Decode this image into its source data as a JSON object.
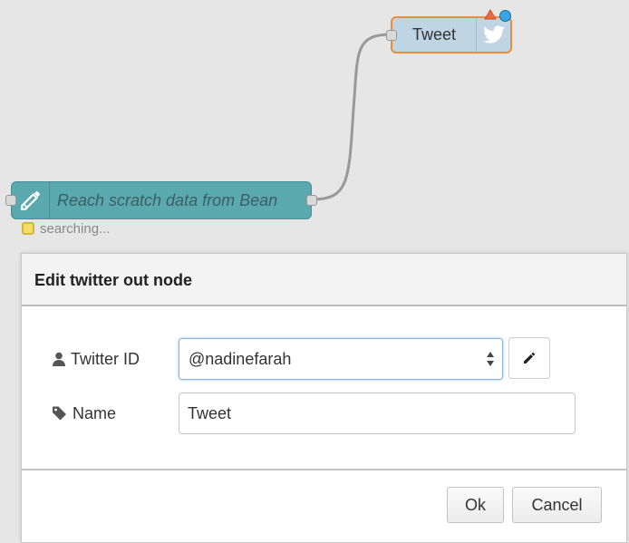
{
  "flow": {
    "tweet_node": {
      "label": "Tweet",
      "icon": "twitter-bird-icon",
      "fill": "#c0d5e3",
      "border": "#f08b3b"
    },
    "inject_node": {
      "label": "Reach scratch data from Bean",
      "icon": "pencil-icon",
      "fill": "#5aa9ae"
    },
    "status": {
      "text": "searching...",
      "color": "#f0e068"
    }
  },
  "dialog": {
    "title": "Edit twitter out node",
    "fields": {
      "twitter_id": {
        "label": "Twitter ID",
        "icon": "user-icon",
        "value": "@nadinefarah"
      },
      "name": {
        "label": "Name",
        "icon": "tag-icon",
        "value": "Tweet"
      }
    },
    "buttons": {
      "ok": "Ok",
      "cancel": "Cancel"
    }
  }
}
